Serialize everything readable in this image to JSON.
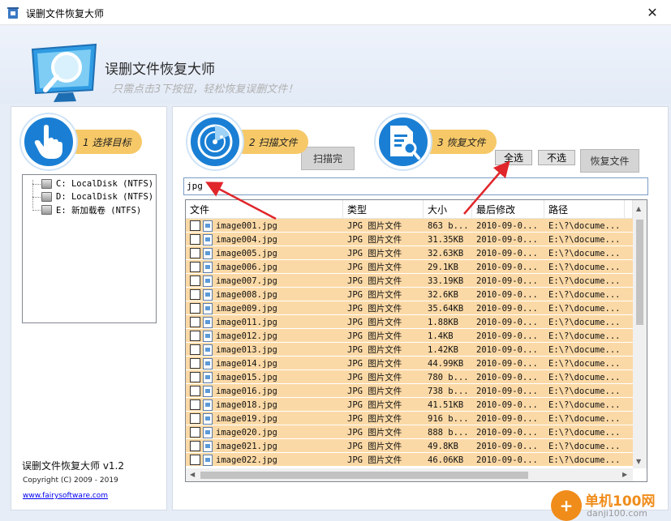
{
  "window": {
    "title": "误删文件恢复大师",
    "close_glyph": "✕"
  },
  "banner": {
    "title": "误删文件恢复大师",
    "subtitle": "只需点击3下按钮，轻松恢复误删文件！"
  },
  "steps": [
    {
      "label": "1 选择目标",
      "icon": "hand-pointer-icon"
    },
    {
      "label": "2 扫描文件",
      "icon": "radar-icon"
    },
    {
      "label": "3 恢复文件",
      "icon": "document-search-icon"
    }
  ],
  "buttons": {
    "scan": "扫描完",
    "select_all": "全选",
    "deselect_all": "不选",
    "recover": "恢复文件"
  },
  "drives": [
    "C: LocalDisk (NTFS)",
    "D: LocalDisk (NTFS)",
    "E: 新加载卷 (NTFS)"
  ],
  "footer": {
    "version": "误删文件恢复大师 v1.2",
    "copyright": "Copyright (C) 2009 - 2019",
    "website": "www.fairysoftware.com"
  },
  "filter": {
    "value": "jpg"
  },
  "table": {
    "columns": [
      "文件",
      "类型",
      "大小",
      "最后修改",
      "路径",
      ""
    ],
    "rows": [
      {
        "name": "image001.jpg",
        "type": "JPG 图片文件",
        "size": "863 b...",
        "modified": "2010-09-0...",
        "path": "E:\\?\\docume..."
      },
      {
        "name": "image004.jpg",
        "type": "JPG 图片文件",
        "size": "31.35KB",
        "modified": "2010-09-0...",
        "path": "E:\\?\\docume..."
      },
      {
        "name": "image005.jpg",
        "type": "JPG 图片文件",
        "size": "32.63KB",
        "modified": "2010-09-0...",
        "path": "E:\\?\\docume..."
      },
      {
        "name": "image006.jpg",
        "type": "JPG 图片文件",
        "size": "29.1KB",
        "modified": "2010-09-0...",
        "path": "E:\\?\\docume..."
      },
      {
        "name": "image007.jpg",
        "type": "JPG 图片文件",
        "size": "33.19KB",
        "modified": "2010-09-0...",
        "path": "E:\\?\\docume..."
      },
      {
        "name": "image008.jpg",
        "type": "JPG 图片文件",
        "size": "32.6KB",
        "modified": "2010-09-0...",
        "path": "E:\\?\\docume..."
      },
      {
        "name": "image009.jpg",
        "type": "JPG 图片文件",
        "size": "35.64KB",
        "modified": "2010-09-0...",
        "path": "E:\\?\\docume..."
      },
      {
        "name": "image011.jpg",
        "type": "JPG 图片文件",
        "size": "1.88KB",
        "modified": "2010-09-0...",
        "path": "E:\\?\\docume..."
      },
      {
        "name": "image012.jpg",
        "type": "JPG 图片文件",
        "size": "1.4KB",
        "modified": "2010-09-0...",
        "path": "E:\\?\\docume..."
      },
      {
        "name": "image013.jpg",
        "type": "JPG 图片文件",
        "size": "1.42KB",
        "modified": "2010-09-0...",
        "path": "E:\\?\\docume..."
      },
      {
        "name": "image014.jpg",
        "type": "JPG 图片文件",
        "size": "44.99KB",
        "modified": "2010-09-0...",
        "path": "E:\\?\\docume..."
      },
      {
        "name": "image015.jpg",
        "type": "JPG 图片文件",
        "size": "780 b...",
        "modified": "2010-09-0...",
        "path": "E:\\?\\docume..."
      },
      {
        "name": "image016.jpg",
        "type": "JPG 图片文件",
        "size": "738 b...",
        "modified": "2010-09-0...",
        "path": "E:\\?\\docume..."
      },
      {
        "name": "image018.jpg",
        "type": "JPG 图片文件",
        "size": "41.51KB",
        "modified": "2010-09-0...",
        "path": "E:\\?\\docume..."
      },
      {
        "name": "image019.jpg",
        "type": "JPG 图片文件",
        "size": "916 b...",
        "modified": "2010-09-0...",
        "path": "E:\\?\\docume..."
      },
      {
        "name": "image020.jpg",
        "type": "JPG 图片文件",
        "size": "888 b...",
        "modified": "2010-09-0...",
        "path": "E:\\?\\docume..."
      },
      {
        "name": "image021.jpg",
        "type": "JPG 图片文件",
        "size": "49.8KB",
        "modified": "2010-09-0...",
        "path": "E:\\?\\docume..."
      },
      {
        "name": "image022.jpg",
        "type": "JPG 图片文件",
        "size": "46.06KB",
        "modified": "2010-09-0...",
        "path": "E:\\?\\docume..."
      }
    ]
  },
  "watermark": {
    "brand": "单机100网",
    "url": "danji100.com",
    "glyph": "+"
  },
  "colors": {
    "row_highlight": "#fbd9a6",
    "step_pill": "#f6c867",
    "step_circle": "#1a7fd4",
    "annotation_arrow": "#e0262b",
    "banner_bg": "#e3ebf7"
  }
}
